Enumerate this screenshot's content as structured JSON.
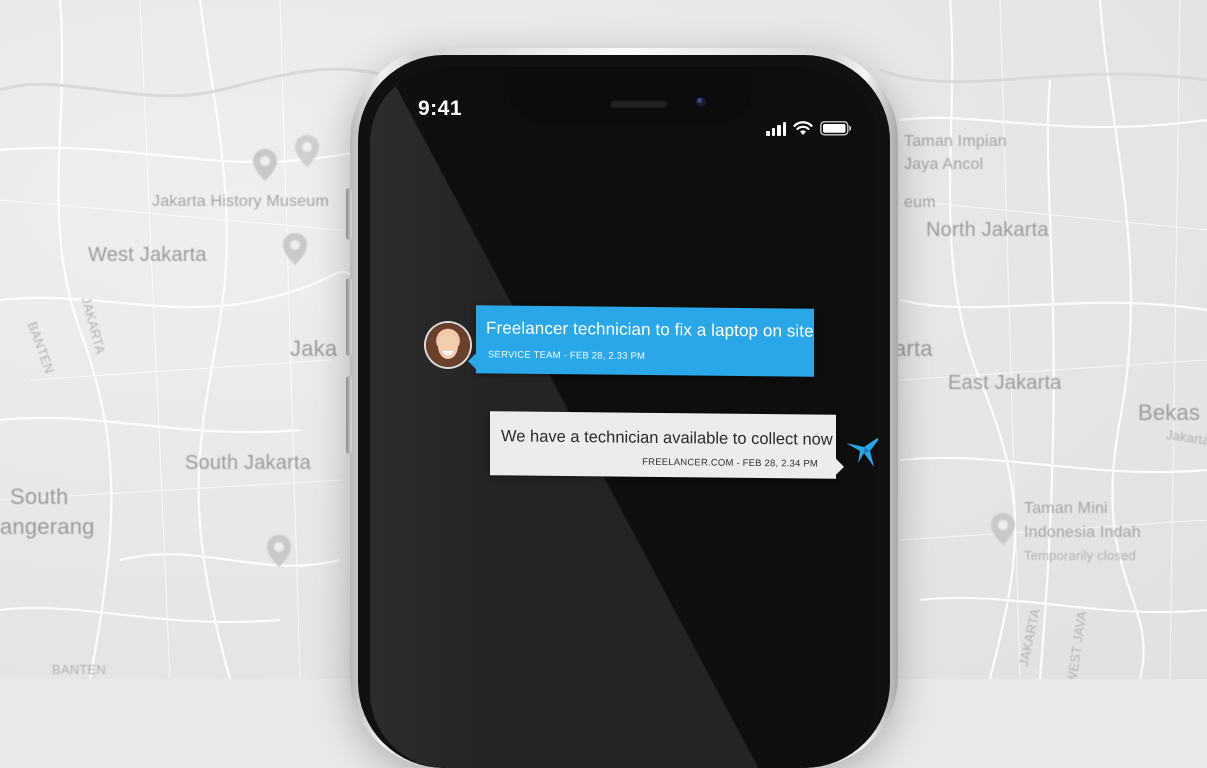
{
  "map": {
    "labels": [
      "West Jakarta",
      "Jakarta History Museum",
      "North Jakarta",
      "Jaka",
      "arta",
      "East Jakarta",
      "South Jakarta",
      "South",
      "angerang",
      "Bekas",
      "Jakarta",
      "Taman Impian",
      "Jaya Ancol",
      "eum",
      "Taman Mini",
      "Indonesia Indah",
      "Temporarily closed",
      "BANTEN",
      "JAKARTA",
      "BANTEN",
      "JAKARTA",
      "WEST JAVA"
    ],
    "colors": {
      "background": "#e9e9e9",
      "road": "#ffffff",
      "label": "#9b9b9b"
    }
  },
  "phone": {
    "status": {
      "time": "9:41"
    },
    "icons": [
      "signal-icon",
      "wifi-icon",
      "battery-icon"
    ]
  },
  "chat": {
    "incoming": {
      "text": "Freelancer technician to fix a laptop on site",
      "meta": "SERVICE TEAM - FEB 28, 2.33 PM",
      "color": "#29a7e9"
    },
    "outgoing": {
      "text": "We have a technician available to collect now",
      "meta": "FREELANCER.COM - FEB 28, 2.34 PM",
      "color": "#ececec"
    },
    "brand_icon": "freelancer-bird-icon",
    "brand_color": "#29a7e9"
  }
}
